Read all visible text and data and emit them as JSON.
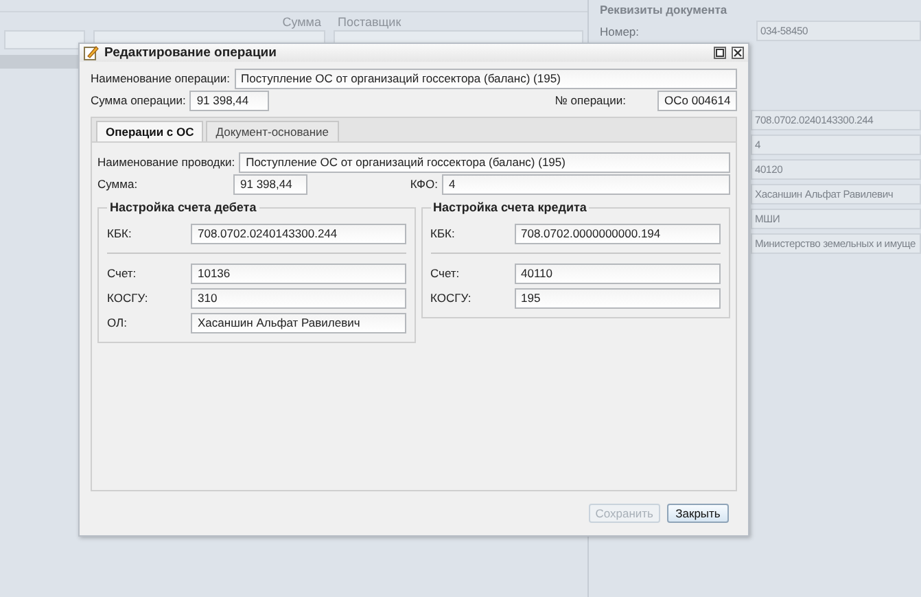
{
  "background": {
    "columns": [
      {
        "label": "Сумма"
      },
      {
        "label": "Поставщик"
      }
    ],
    "details": {
      "title": "Реквизиты документа",
      "number_label": "Номер:",
      "number": "034-58450",
      "values": [
        "708.0702.0240143300.244",
        "4",
        "40120",
        "Хасаншин Альфат Равилевич",
        "МШИ",
        "Министерство земельных и имуще"
      ]
    }
  },
  "dialog": {
    "title": "Редактирование операции",
    "operation_name_label": "Наименование операции:",
    "operation_name": "Поступление ОС от организаций госсектора (баланс) (195)",
    "amount_label": "Сумма операции:",
    "amount": "91 398,44",
    "number_label": "№ операции:",
    "number": "ОСо 004614",
    "tabs": [
      {
        "label": "Операции с ОС",
        "selected": true
      },
      {
        "label": "Документ-основание",
        "selected": false
      }
    ],
    "posting_label": "Наименование проводки:",
    "posting": "Поступление ОС от организаций госсектора (баланс) (195)",
    "sum_label": "Сумма:",
    "sum": "91 398,44",
    "kfo_label": "КФО:",
    "kfo": "4",
    "debit": {
      "title": "Настройка счета дебета",
      "fields": [
        {
          "label": "КБК:",
          "value": "708.0702.0240143300.244"
        },
        {
          "label": "Счет:",
          "value": "10136"
        },
        {
          "label": "КОСГУ:",
          "value": "310"
        },
        {
          "label": "ОЛ:",
          "value": "Хасаншин Альфат Равилевич"
        }
      ]
    },
    "credit": {
      "title": "Настройка счета кредита",
      "fields": [
        {
          "label": "КБК:",
          "value": "708.0702.0000000000.194"
        },
        {
          "label": "Счет:",
          "value": "40110"
        },
        {
          "label": "КОСГУ:",
          "value": "195"
        }
      ]
    },
    "buttons": [
      {
        "label": "Сохранить",
        "disabled": true
      },
      {
        "label": "Закрыть",
        "disabled": false
      }
    ]
  }
}
